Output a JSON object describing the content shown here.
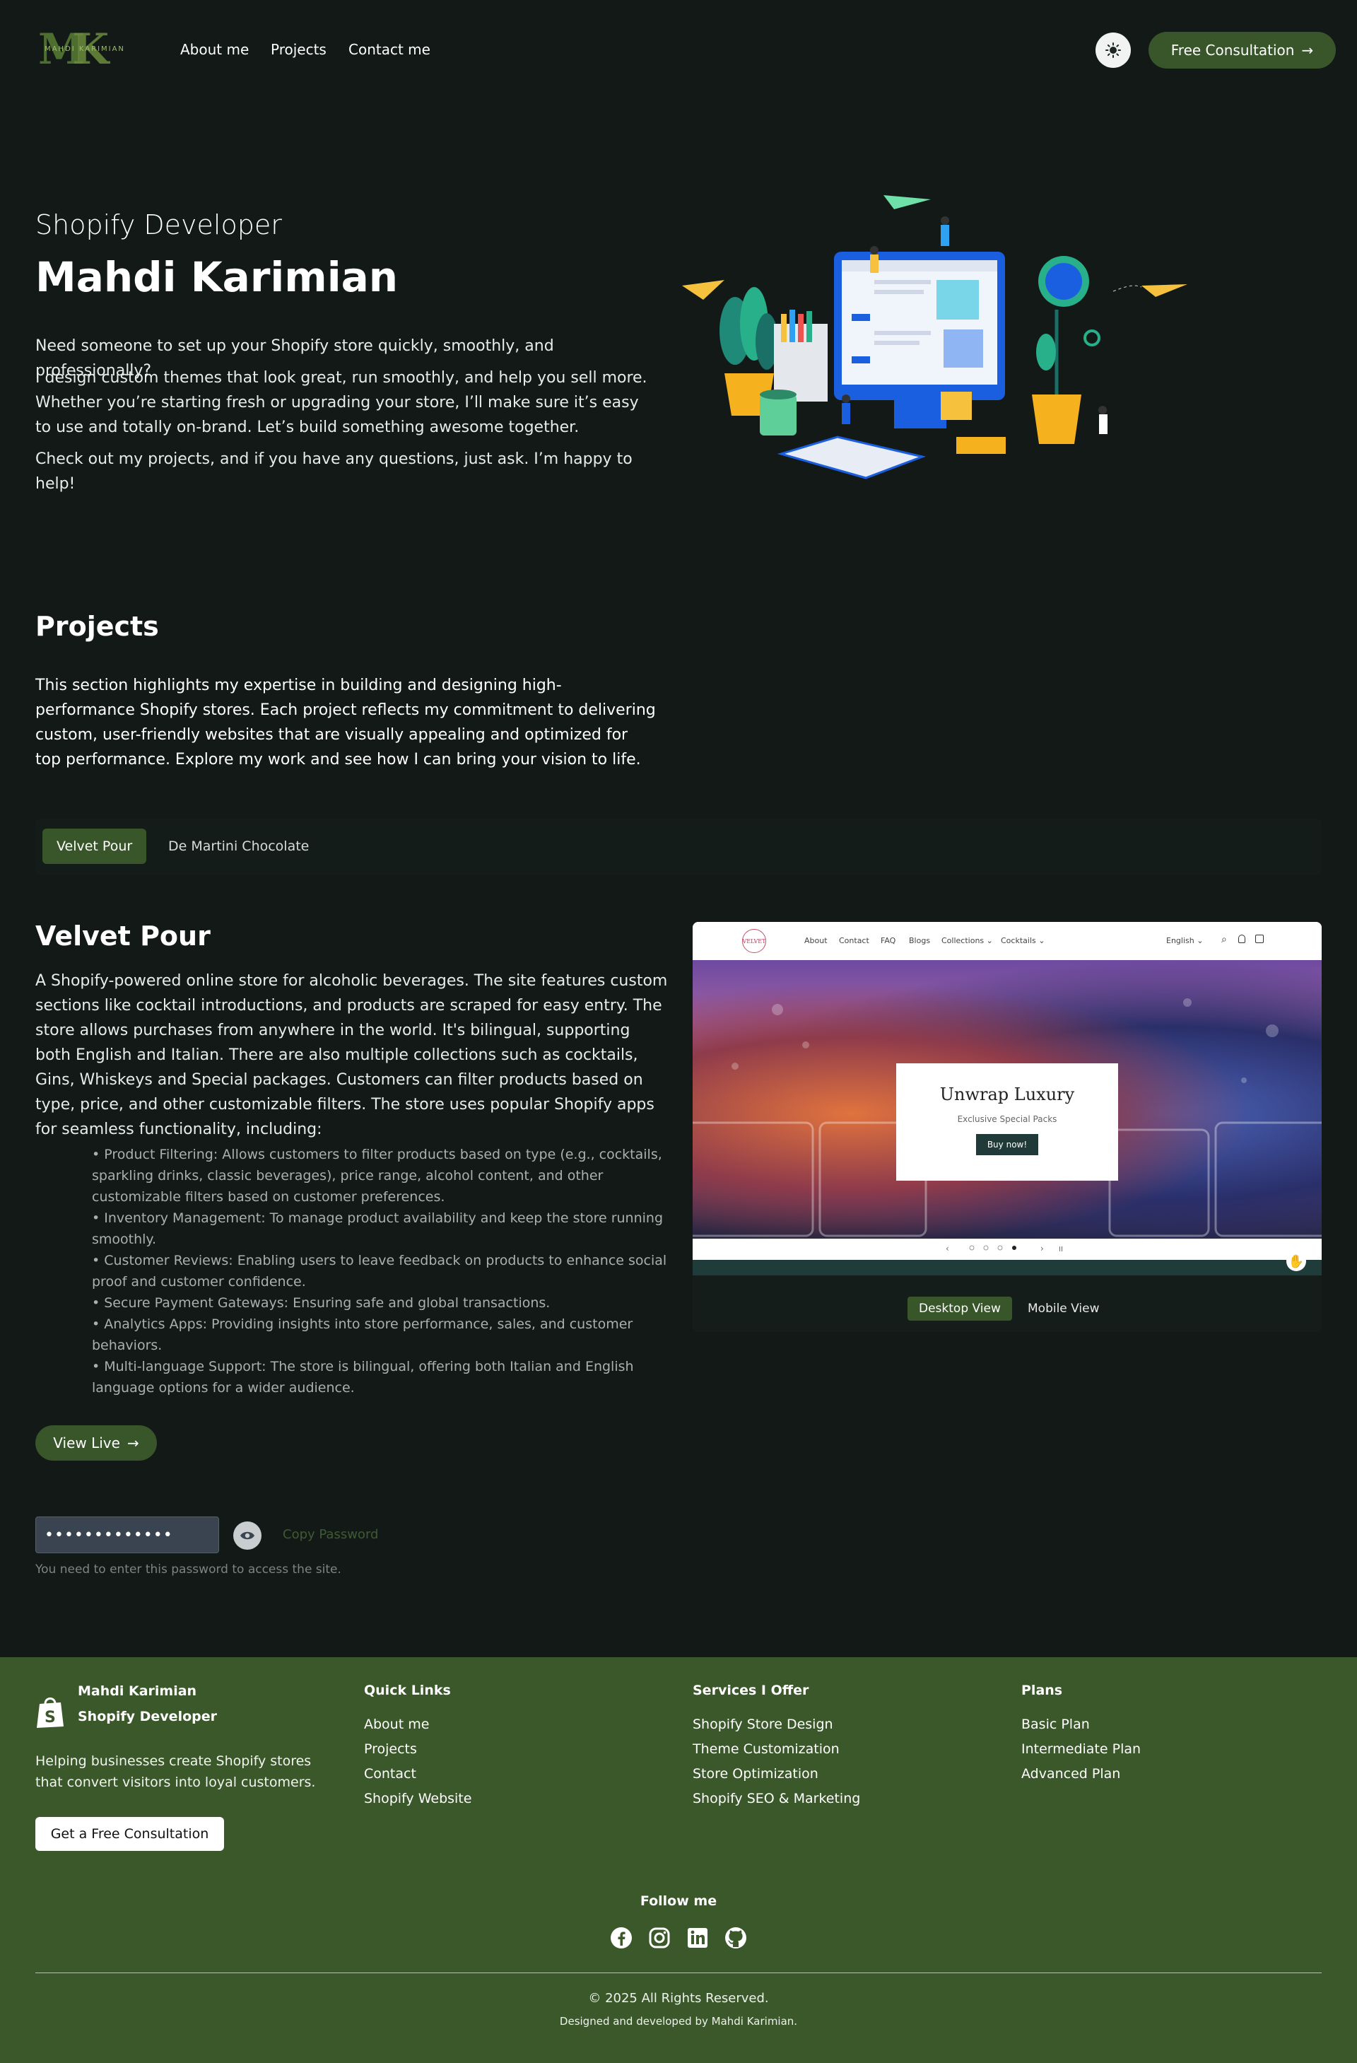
{
  "header": {
    "logo_letters": "MK",
    "logo_name": "MAHDI KARIMIAN",
    "nav": [
      "About me",
      "Projects",
      "Contact me"
    ],
    "cta_label": "Free Consultation"
  },
  "hero": {
    "subtitle": "Shopify Developer",
    "title": "Mahdi Karimian",
    "p1": "Need someone to set up your Shopify store quickly, smoothly, and professionally?",
    "p2": "I design custom themes that look great, run smoothly, and help you sell more. Whether you’re starting fresh or upgrading your store, I’ll make sure it’s easy to use and totally on-brand. Let’s build something awesome together.",
    "p3": "Check out my projects, and if you have any questions, just ask. I’m happy to help!"
  },
  "projects": {
    "title": "Projects",
    "description": "This section highlights my expertise in building and designing high-performance Shopify stores. Each project reflects my commitment to delivering custom, user-friendly websites that are visually appealing and optimized for top performance. Explore my work and see how I can bring your vision to life.",
    "tabs": [
      "Velvet Pour",
      "De Martini Chocolate"
    ],
    "active_tab": "Velvet Pour"
  },
  "project": {
    "title": "Velvet Pour",
    "description": "A Shopify-powered online store for alcoholic beverages. The site features custom sections like cocktail introductions, and products are scraped for easy entry. The store allows purchases from anywhere in the world. It's bilingual, supporting both English and Italian. There are also multiple collections such as cocktails, Gins, Whiskeys and Special packages. Customers can filter products based on type, price, and other customizable filters. The store uses popular Shopify apps for seamless functionality, including:",
    "features": [
      "Product Filtering: Allows customers to filter products based on type (e.g., cocktails, sparkling drinks, classic beverages), price range, alcohol content, and other customizable filters based on customer preferences.",
      "Inventory Management: To manage product availability and keep the store running smoothly.",
      "Customer Reviews: Enabling users to leave feedback on products to enhance social proof and customer confidence.",
      "Secure Payment Gateways: Ensuring safe and global transactions.",
      "Analytics Apps: Providing insights into store performance, sales, and customer behaviors.",
      "Multi-language Support: The store is bilingual, offering both Italian and English language options for a wider audience."
    ],
    "view_live_label": "View Live",
    "password_mask": "•••••••••••••",
    "copy_password_label": "Copy Password",
    "password_note": "You need to enter this password to access the site.",
    "preview": {
      "site_logo": "VELVET",
      "nav_items": [
        "About",
        "Contact",
        "FAQ",
        "Blogs",
        "Collections ⌄",
        "Cocktails ⌄"
      ],
      "language": "English ⌄",
      "banner_title": "Unwrap Luxury",
      "banner_subtitle": "Exclusive Special Packs",
      "banner_button": "Buy now!",
      "desktop_view_label": "Desktop View",
      "mobile_view_label": "Mobile View"
    }
  },
  "footer": {
    "brand_name": "Mahdi Karimian",
    "brand_role": "Shopify Developer",
    "tagline": "Helping businesses create Shopify stores that convert visitors into loyal customers.",
    "cta_label": "Get a Free Consultation",
    "columns": [
      {
        "title": "Quick Links",
        "links": [
          "About me",
          "Projects",
          "Contact",
          "Shopify Website"
        ]
      },
      {
        "title": "Services I Offer",
        "links": [
          "Shopify Store Design",
          "Theme Customization",
          "Store Optimization",
          "Shopify SEO & Marketing"
        ]
      },
      {
        "title": "Plans",
        "links": [
          "Basic Plan",
          "Intermediate Plan",
          "Advanced Plan"
        ]
      }
    ],
    "follow_label": "Follow me",
    "social_icons": [
      "facebook-icon",
      "instagram-icon",
      "linkedin-icon",
      "github-icon"
    ],
    "copyright": "© 2025 All Rights Reserved.",
    "credit": "Designed and developed by Mahdi Karimian."
  },
  "colors": {
    "background": "#121917",
    "accent": "#38562a",
    "footer": "#3a5829"
  }
}
